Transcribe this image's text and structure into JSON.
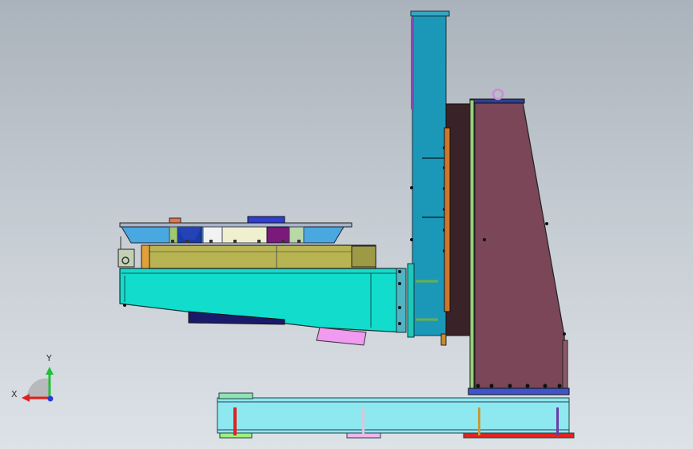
{
  "viewport": {
    "background_top": "#aab2bb",
    "background_bottom": "#dde2e7"
  },
  "triad": {
    "x_label": "X",
    "y_label": "Y",
    "x_color": "#e0201b",
    "y_color": "#21c03a",
    "z_color": "#2a3ad8"
  },
  "parts": {
    "base_color": "#8de8f0",
    "column_color": "#1b98b8",
    "housing_color": "#7a4658",
    "boom_color": "#12dccc",
    "turntable_color": "#b8b454"
  }
}
